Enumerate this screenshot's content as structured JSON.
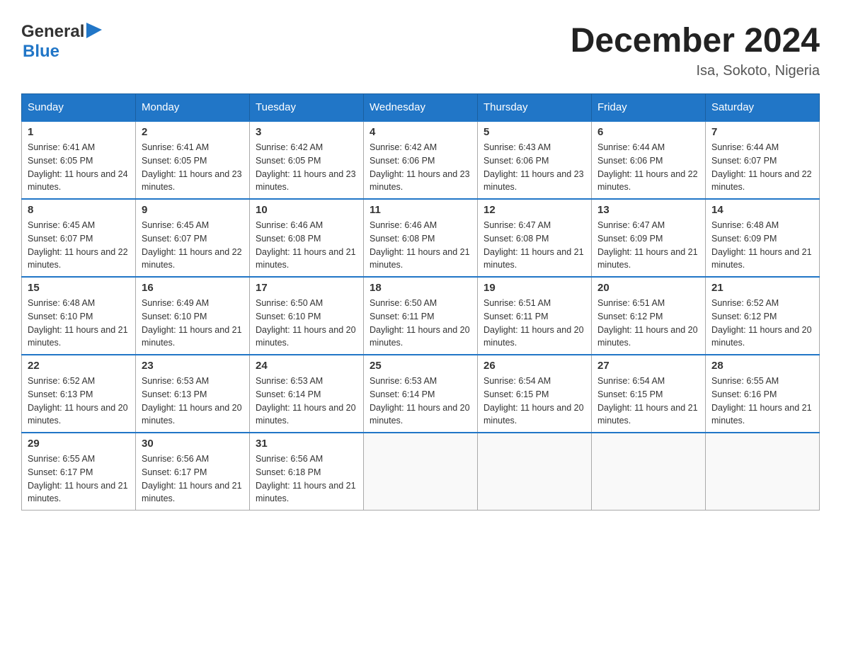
{
  "logo": {
    "general": "General",
    "triangle": "▶",
    "blue": "Blue"
  },
  "title": "December 2024",
  "location": "Isa, Sokoto, Nigeria",
  "headers": [
    "Sunday",
    "Monday",
    "Tuesday",
    "Wednesday",
    "Thursday",
    "Friday",
    "Saturday"
  ],
  "weeks": [
    [
      {
        "day": "1",
        "sunrise": "6:41 AM",
        "sunset": "6:05 PM",
        "daylight": "11 hours and 24 minutes."
      },
      {
        "day": "2",
        "sunrise": "6:41 AM",
        "sunset": "6:05 PM",
        "daylight": "11 hours and 23 minutes."
      },
      {
        "day": "3",
        "sunrise": "6:42 AM",
        "sunset": "6:05 PM",
        "daylight": "11 hours and 23 minutes."
      },
      {
        "day": "4",
        "sunrise": "6:42 AM",
        "sunset": "6:06 PM",
        "daylight": "11 hours and 23 minutes."
      },
      {
        "day": "5",
        "sunrise": "6:43 AM",
        "sunset": "6:06 PM",
        "daylight": "11 hours and 23 minutes."
      },
      {
        "day": "6",
        "sunrise": "6:44 AM",
        "sunset": "6:06 PM",
        "daylight": "11 hours and 22 minutes."
      },
      {
        "day": "7",
        "sunrise": "6:44 AM",
        "sunset": "6:07 PM",
        "daylight": "11 hours and 22 minutes."
      }
    ],
    [
      {
        "day": "8",
        "sunrise": "6:45 AM",
        "sunset": "6:07 PM",
        "daylight": "11 hours and 22 minutes."
      },
      {
        "day": "9",
        "sunrise": "6:45 AM",
        "sunset": "6:07 PM",
        "daylight": "11 hours and 22 minutes."
      },
      {
        "day": "10",
        "sunrise": "6:46 AM",
        "sunset": "6:08 PM",
        "daylight": "11 hours and 21 minutes."
      },
      {
        "day": "11",
        "sunrise": "6:46 AM",
        "sunset": "6:08 PM",
        "daylight": "11 hours and 21 minutes."
      },
      {
        "day": "12",
        "sunrise": "6:47 AM",
        "sunset": "6:08 PM",
        "daylight": "11 hours and 21 minutes."
      },
      {
        "day": "13",
        "sunrise": "6:47 AM",
        "sunset": "6:09 PM",
        "daylight": "11 hours and 21 minutes."
      },
      {
        "day": "14",
        "sunrise": "6:48 AM",
        "sunset": "6:09 PM",
        "daylight": "11 hours and 21 minutes."
      }
    ],
    [
      {
        "day": "15",
        "sunrise": "6:48 AM",
        "sunset": "6:10 PM",
        "daylight": "11 hours and 21 minutes."
      },
      {
        "day": "16",
        "sunrise": "6:49 AM",
        "sunset": "6:10 PM",
        "daylight": "11 hours and 21 minutes."
      },
      {
        "day": "17",
        "sunrise": "6:50 AM",
        "sunset": "6:10 PM",
        "daylight": "11 hours and 20 minutes."
      },
      {
        "day": "18",
        "sunrise": "6:50 AM",
        "sunset": "6:11 PM",
        "daylight": "11 hours and 20 minutes."
      },
      {
        "day": "19",
        "sunrise": "6:51 AM",
        "sunset": "6:11 PM",
        "daylight": "11 hours and 20 minutes."
      },
      {
        "day": "20",
        "sunrise": "6:51 AM",
        "sunset": "6:12 PM",
        "daylight": "11 hours and 20 minutes."
      },
      {
        "day": "21",
        "sunrise": "6:52 AM",
        "sunset": "6:12 PM",
        "daylight": "11 hours and 20 minutes."
      }
    ],
    [
      {
        "day": "22",
        "sunrise": "6:52 AM",
        "sunset": "6:13 PM",
        "daylight": "11 hours and 20 minutes."
      },
      {
        "day": "23",
        "sunrise": "6:53 AM",
        "sunset": "6:13 PM",
        "daylight": "11 hours and 20 minutes."
      },
      {
        "day": "24",
        "sunrise": "6:53 AM",
        "sunset": "6:14 PM",
        "daylight": "11 hours and 20 minutes."
      },
      {
        "day": "25",
        "sunrise": "6:53 AM",
        "sunset": "6:14 PM",
        "daylight": "11 hours and 20 minutes."
      },
      {
        "day": "26",
        "sunrise": "6:54 AM",
        "sunset": "6:15 PM",
        "daylight": "11 hours and 20 minutes."
      },
      {
        "day": "27",
        "sunrise": "6:54 AM",
        "sunset": "6:15 PM",
        "daylight": "11 hours and 21 minutes."
      },
      {
        "day": "28",
        "sunrise": "6:55 AM",
        "sunset": "6:16 PM",
        "daylight": "11 hours and 21 minutes."
      }
    ],
    [
      {
        "day": "29",
        "sunrise": "6:55 AM",
        "sunset": "6:17 PM",
        "daylight": "11 hours and 21 minutes."
      },
      {
        "day": "30",
        "sunrise": "6:56 AM",
        "sunset": "6:17 PM",
        "daylight": "11 hours and 21 minutes."
      },
      {
        "day": "31",
        "sunrise": "6:56 AM",
        "sunset": "6:18 PM",
        "daylight": "11 hours and 21 minutes."
      },
      null,
      null,
      null,
      null
    ]
  ]
}
